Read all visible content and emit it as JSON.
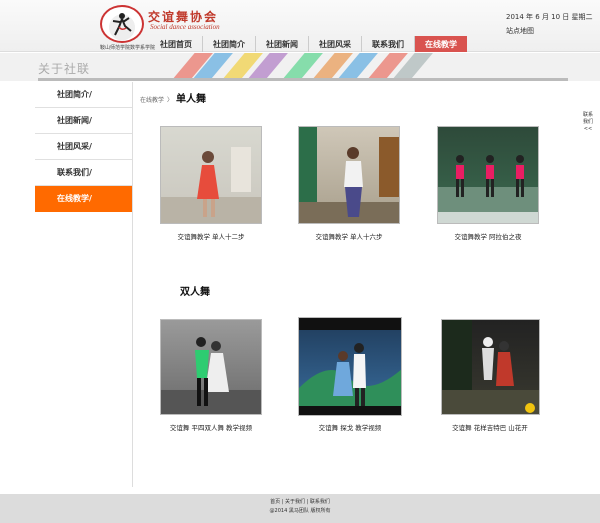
{
  "header": {
    "logo_title": "交谊舞协会",
    "logo_subtitle": "Social dance association",
    "logo_school": "鞍山师范学院数学系学院",
    "date": "2014 年 6 月 10 日  星期二",
    "sitemap": "站点地图"
  },
  "nav": {
    "items": [
      "社团首页",
      "社团简介",
      "社团新闻",
      "社团风采",
      "联系我们",
      "在线教学"
    ],
    "active": "在线教学"
  },
  "banner": {
    "title": "关于社联"
  },
  "sidebar": {
    "items": [
      "社团简介/",
      "社团新闻/",
      "社团风采/",
      "联系我们/",
      "在线教学/"
    ]
  },
  "breadcrumb": {
    "parent": "在线教学",
    "separator": "〉",
    "current": "单人舞"
  },
  "sections": {
    "single_title": "单人舞",
    "double_title": "双人舞"
  },
  "videos": {
    "single": [
      {
        "caption": "交谊舞教学  单人十二步"
      },
      {
        "caption": "交谊舞教学  单人十六步"
      },
      {
        "caption": "交谊舞教学  阿拉伯之夜"
      }
    ],
    "double": [
      {
        "caption": "交谊舞  平四双人舞  教学视频"
      },
      {
        "caption": "交谊舞   探戈  教学视频"
      },
      {
        "caption": "交谊舞  花样吉特巴  山花开"
      }
    ]
  },
  "side_float": {
    "text": "联系我们",
    "arrow": "<<"
  },
  "footer": {
    "links": "首页 | 关于我们 | 联系我们",
    "copyright": "@2014  黑马团队  版权所有"
  },
  "colors": {
    "accent": "#ff6a00",
    "nav_active": "#d9534f",
    "brand_red": "#c0392b"
  }
}
